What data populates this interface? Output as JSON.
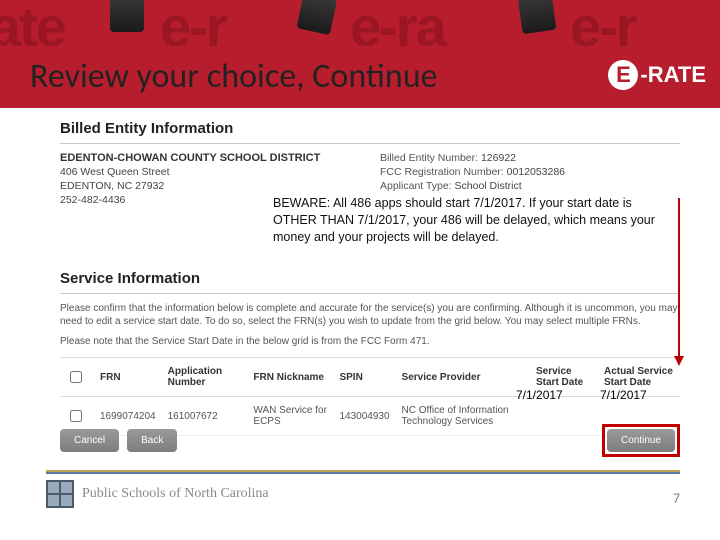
{
  "slide": {
    "title": "Review your choice, Continue",
    "page_number": "7",
    "footer_org": "Public Schools of North Carolina",
    "erate_logo": {
      "e": "E",
      "rate": "-RATE"
    }
  },
  "billed_entity": {
    "heading": "Billed Entity Information",
    "name": "EDENTON-CHOWAN COUNTY SCHOOL DISTRICT",
    "street": "406 West Queen Street",
    "city_state_zip": "EDENTON, NC 27932",
    "phone": "252-482-4436",
    "ben_label": "Billed Entity Number:",
    "ben": "126922",
    "fcc_label": "FCC Registration Number:",
    "fcc": "0012053286",
    "type_label": "Applicant Type:",
    "type": "School District"
  },
  "beware": "BEWARE: All 486 apps should start 7/1/2017.  If your start date is OTHER THAN 7/1/2017, your 486 will be delayed, which means your money and your projects will be delayed.",
  "service_info": {
    "heading": "Service Information",
    "confirm_text": "Please confirm that the information below is complete and accurate for the service(s) you are confirming. Although it is uncommon, you may need to edit a service start date. To do so, select the FRN(s) you wish to update from the grid below. You may select multiple FRNs.",
    "note_text": "Please note that the Service Start Date in the below grid is from the FCC Form 471."
  },
  "table": {
    "headers": {
      "frn": "FRN",
      "app_no": "Application Number",
      "nickname": "FRN Nickname",
      "spin": "SPIN",
      "provider": "Service Provider",
      "ssd": "Service Start Date",
      "assd": "Actual Service Start Date"
    },
    "rows": [
      {
        "frn": "1699074204",
        "app_no": "161007672",
        "nickname": "WAN Service for ECPS",
        "spin": "143004930",
        "provider": "NC Office of Information Technology Services",
        "ssd": "7/1/2017",
        "assd": "7/1/2017"
      }
    ]
  },
  "buttons": {
    "cancel": "Cancel",
    "back": "Back",
    "continue": "Continue"
  }
}
